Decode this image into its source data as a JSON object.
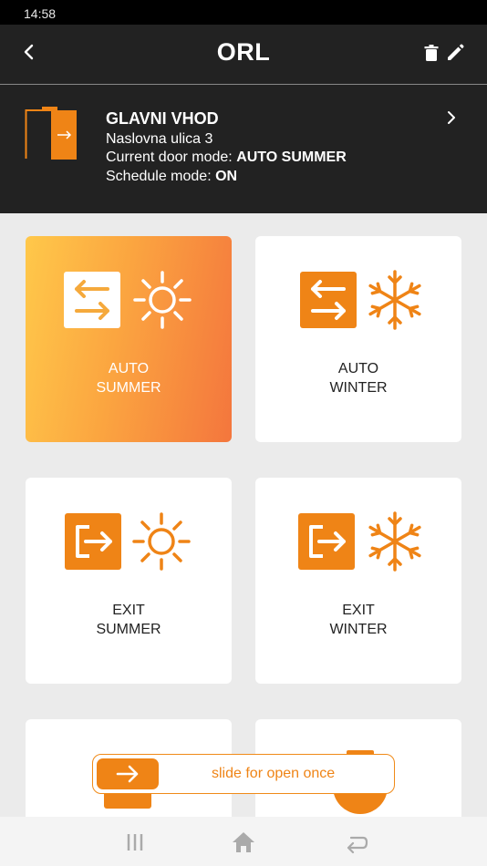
{
  "status_bar": {
    "time": "14:58"
  },
  "app_bar": {
    "title": "ORL"
  },
  "door": {
    "name": "GLAVNI VHOD",
    "address": "Naslovna ulica 3",
    "mode_label": "Current door mode: ",
    "mode_value": "AUTO SUMMER",
    "schedule_label": "Schedule mode: ",
    "schedule_value": "ON"
  },
  "modes": [
    {
      "line1": "AUTO",
      "line2": "SUMMER",
      "active": true,
      "icons": [
        "auto-arrows-icon",
        "sun-icon"
      ]
    },
    {
      "line1": "AUTO",
      "line2": "WINTER",
      "active": false,
      "icons": [
        "auto-arrows-icon",
        "snowflake-icon"
      ]
    },
    {
      "line1": "EXIT",
      "line2": "SUMMER",
      "active": false,
      "icons": [
        "exit-icon",
        "sun-icon"
      ]
    },
    {
      "line1": "EXIT",
      "line2": "WINTER",
      "active": false,
      "icons": [
        "exit-icon",
        "snowflake-icon"
      ]
    }
  ],
  "slide": {
    "label": "slide for open once"
  },
  "colors": {
    "accent": "#ef8416",
    "header": "#222222",
    "background": "#ebebeb"
  }
}
